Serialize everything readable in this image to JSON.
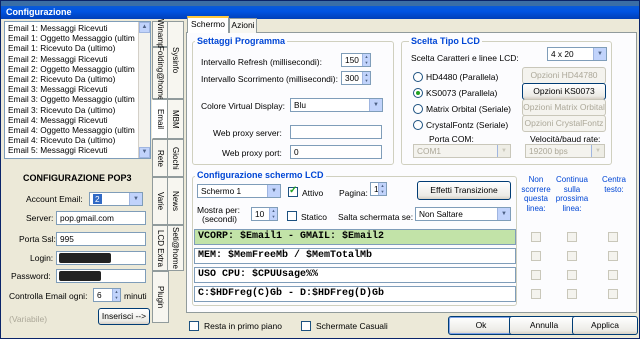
{
  "window": {
    "title": "Configurazione"
  },
  "email_list": [
    "Email 1: Messaggi Ricevuti",
    "Email 1: Oggetto Messaggio (ultim",
    "Email 1: Ricevuto Da (ultimo)",
    "Email 2: Messaggi Ricevuti",
    "Email 2: Oggetto Messaggio (ultim",
    "Email 2: Ricevuto Da (ultimo)",
    "Email 3: Messaggi Ricevuti",
    "Email 3: Oggetto Messaggio (ultim",
    "Email 3: Ricevuto Da (ultimo)",
    "Email 4: Messaggi Ricevuti",
    "Email 4: Oggetto Messaggio (ultim",
    "Email 4: Ricevuto Da (ultimo)",
    "Email 5: Messaggi Ricevuti"
  ],
  "side_tabs": [
    "Winamp",
    "Folding@home",
    "Sysinfo",
    "Email",
    "MBM",
    "Rete",
    "Giochi",
    "Varie",
    "News",
    "LCD Extra",
    "Seti@home",
    "Plugin"
  ],
  "pop3": {
    "title": "CONFIGURAZIONE POP3",
    "account_label": "Account Email:",
    "account_value": "2",
    "server_label": "Server:",
    "server_value": "pop.gmail.com",
    "port_label": "Porta Ssl:",
    "port_value": "995",
    "login_label": "Login:",
    "password_label": "Password:",
    "check_label": "Controlla Email ogni:",
    "check_value": "6",
    "check_unit": "minuti",
    "variable": "(Variabile)",
    "insert_button": "Inserisci -->"
  },
  "top_tabs": [
    "Schermo",
    "Azioni"
  ],
  "settings": {
    "title": "Settaggi Programma",
    "refresh_label": "Intervallo Refresh (millisecondi):",
    "refresh_value": "150",
    "scroll_label": "Intervallo Scorrimento (millisecondi):",
    "scroll_value": "300",
    "color_label": "Colore Virtual Display:",
    "color_value": "Blu",
    "proxy_server_label": "Web proxy server:",
    "proxy_server_value": "",
    "proxy_port_label": "Web proxy port:",
    "proxy_port_value": "0"
  },
  "lcd_type": {
    "title": "Scelta Tipo LCD",
    "size_label": "Scelta Caratteri e linee LCD:",
    "size_value": "4 x 20",
    "options": [
      {
        "label": "HD4480 (Parallela)",
        "button": "Opzioni HD44780",
        "selected": false,
        "enabled": false
      },
      {
        "label": "KS0073 (Parallela)",
        "button": "Opzioni KS0073",
        "selected": true,
        "enabled": true
      },
      {
        "label": "Matrix Orbital (Seriale)",
        "button": "Opzioni Matrix Orbital",
        "selected": false,
        "enabled": false
      },
      {
        "label": "CrystalFontz (Seriale)",
        "button": "Opzioni CrystalFontz",
        "selected": false,
        "enabled": false
      }
    ],
    "port_label": "Porta COM:",
    "port_value": "COM1",
    "baud_label": "Velocità/baud rate:",
    "baud_value": "19200 bps"
  },
  "screen_config": {
    "title": "Configurazione schermo LCD",
    "screen_value": "Schermo 1",
    "active_label": "Attivo",
    "active": true,
    "page_label": "Pagina:",
    "page_value": "1",
    "transition_button": "Effetti Transizione",
    "show_for_label": "Mostra per:",
    "seconds_label": "(secondi)",
    "show_for_value": "10",
    "static_label": "Statico",
    "skip_label": "Salta schermata se:",
    "skip_value": "Non Saltare",
    "lines": [
      "VCORP: $Email1 - GMAIL: $Email2",
      "MEM: $MemFreeMb / $MemTotalMb",
      "USO CPU: $CPUUsage%%",
      "C:$HDFreg(C)Gb - D:$HDFreg(D)Gb"
    ],
    "col_no_scroll": "Non scorrere questa linea:",
    "col_continue": "Continua sulla prossima linea:",
    "col_center": "Centra testo:"
  },
  "bottom": {
    "tray_label": "Resta in primo piano",
    "random_label": "Schermate Casuali",
    "ok": "Ok",
    "cancel": "Annulla",
    "apply": "Applica"
  },
  "colors": {
    "highlight_row": "#c2e3a8",
    "group_title": "#0046d5",
    "titlebar": "#0054e3"
  }
}
